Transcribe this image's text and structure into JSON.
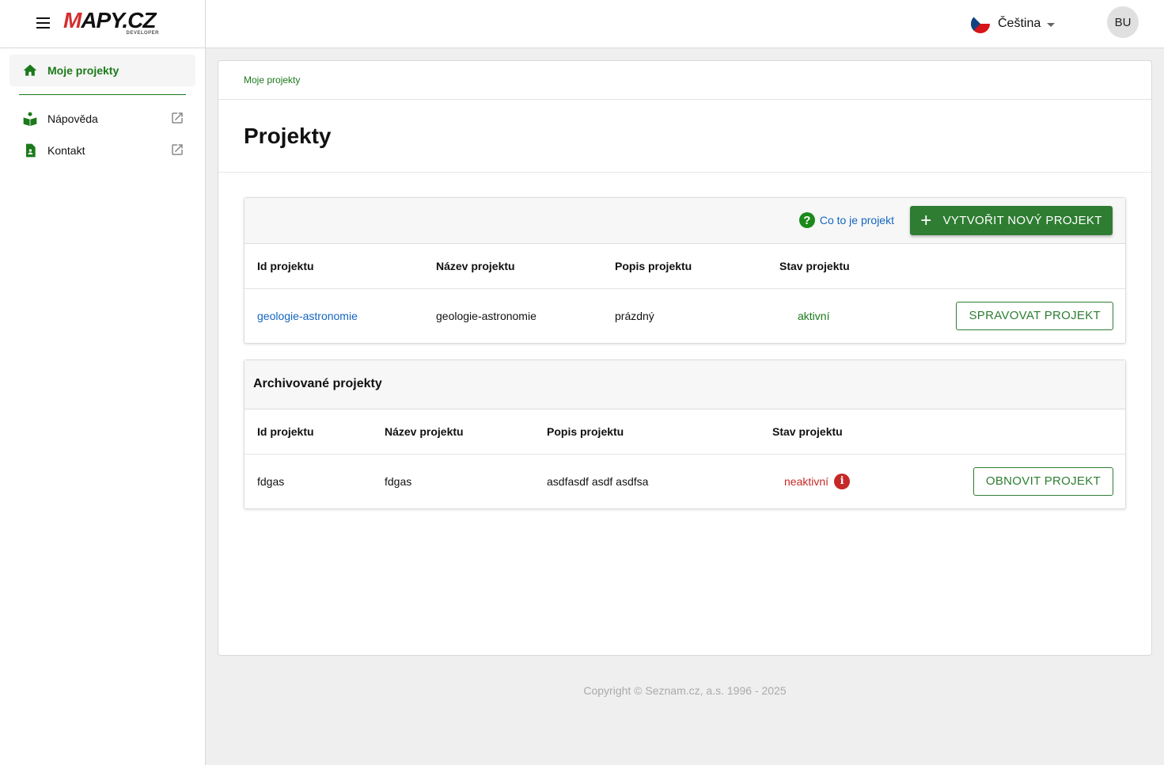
{
  "logo": {
    "text_m": "M",
    "text_rest": "APY.CZ",
    "sub": "DEVELOPER"
  },
  "sidebar": {
    "items": [
      {
        "label": "Moje projekty"
      },
      {
        "label": "Nápověda"
      },
      {
        "label": "Kontakt"
      }
    ]
  },
  "header": {
    "language": "Čeština",
    "avatar": "BU"
  },
  "breadcrumb": "Moje projekty",
  "page_title": "Projekty",
  "projects": {
    "help_link": "Co to je projekt",
    "create_button": "VYTVOŘIT NOVÝ PROJEKT",
    "columns": [
      "Id projektu",
      "Název projektu",
      "Popis projektu",
      "Stav projektu"
    ],
    "rows": [
      {
        "id": "geologie-astronomie",
        "name": "geologie-astronomie",
        "description": "prázdný",
        "status": "aktivní",
        "action": "SPRAVOVAT PROJEKT"
      }
    ]
  },
  "archived": {
    "title": "Archivované projekty",
    "columns": [
      "Id projektu",
      "Název projektu",
      "Popis projektu",
      "Stav projektu"
    ],
    "rows": [
      {
        "id": "fdgas",
        "name": "fdgas",
        "description": "asdfasdf asdf asdfsa",
        "status": "neaktivní",
        "action": "OBNOVIT PROJEKT"
      }
    ]
  },
  "footer": "Copyright © Seznam.cz, a.s. 1996 - 2025",
  "colors": {
    "accent": "#2e7d32",
    "link": "#1565c0",
    "error": "#c62828"
  }
}
